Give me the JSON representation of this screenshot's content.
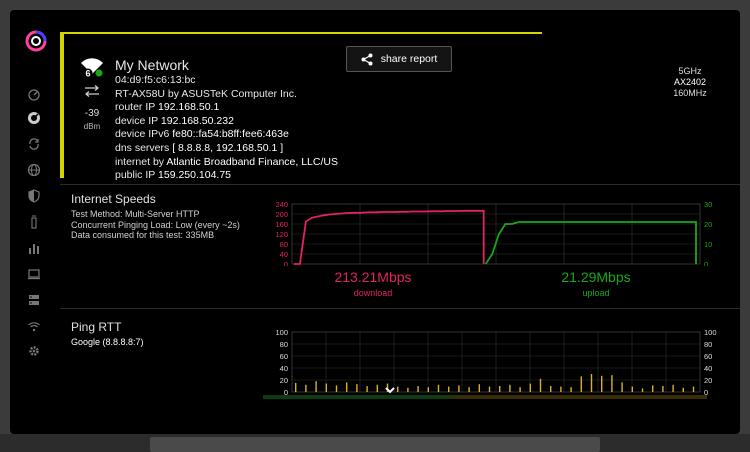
{
  "network": {
    "name": "My Network",
    "mac": "04:d9:f5:c6:13:bc",
    "router_model": "RT-AX58U by ASUSTeK Computer Inc.",
    "router_ip_label": "router IP",
    "router_ip": "192.168.50.1",
    "device_ip_label": "device IP",
    "device_ip": "192.168.50.232",
    "device_ipv6_label": "device IPv6",
    "device_ipv6": "fe80::fa54:b8ff:fee6:463e",
    "dns_label": "dns servers",
    "dns": "[ 8.8.8.8, 192.168.50.1 ]",
    "internet_label": "internet by",
    "internet": "Atlantic Broadband Finance, LLC/US",
    "public_ip_label": "public IP",
    "public_ip": "159.250.104.75",
    "wifi_badge": "6",
    "rssi": "-39",
    "rssi_unit": "dBm",
    "band": "5GHz",
    "standard": "AX2402",
    "width": "160MHz"
  },
  "share_label": "share report",
  "speeds": {
    "title": "Internet Speeds",
    "method": "Test Method: Multi-Server HTTP",
    "load": "Concurrent Pinging Load: Low (every ~2s)",
    "consumed": "Data consumed for this test: 335MB",
    "download_value": "213.21Mbps",
    "download_label": "download",
    "upload_value": "21.29Mbps",
    "upload_label": "upload"
  },
  "ping": {
    "title": "Ping RTT",
    "target": "Google (8.8.8.8:7)"
  },
  "colors": {
    "download": "#e0245e",
    "upload": "#17a817",
    "ping_bar": "#d9b21c",
    "accent": "#d3d600"
  },
  "icons": [
    "logo-icon",
    "speedometer-icon",
    "gauge-icon",
    "refresh-icon",
    "globe-icon",
    "shield-icon",
    "router-icon",
    "bar-chart-icon",
    "laptop-icon",
    "server-icon",
    "wifi-icon",
    "gear-icon"
  ],
  "chart_data": [
    {
      "type": "line",
      "title": "",
      "ylim": [
        0,
        240
      ],
      "yticks_left": [
        "240",
        "200",
        "160",
        "120",
        "80",
        "40",
        "0"
      ],
      "yticks_right": [
        "30",
        "20",
        "10",
        "0"
      ],
      "series": [
        {
          "name": "download",
          "axis": "left",
          "values": [
            0,
            0,
            170,
            185,
            190,
            195,
            198,
            200,
            202,
            204,
            205,
            205,
            206,
            207,
            207,
            208,
            208,
            208,
            209,
            209,
            210,
            210,
            210,
            211,
            211,
            211,
            212,
            212,
            212,
            213,
            213,
            213,
            213
          ]
        },
        {
          "name": "upload",
          "axis": "right",
          "values": [
            0,
            5,
            15,
            20,
            20,
            21,
            21,
            21,
            21,
            21,
            21,
            21,
            21,
            21,
            21,
            21,
            21,
            21,
            21,
            21,
            21,
            21,
            21,
            21,
            21,
            21,
            21,
            21,
            21,
            21,
            21,
            21,
            21
          ]
        }
      ]
    },
    {
      "type": "bar",
      "title": "",
      "ylim": [
        0,
        100
      ],
      "yticks": [
        "100",
        "80",
        "60",
        "40",
        "20",
        "0"
      ],
      "values": [
        15,
        12,
        18,
        14,
        11,
        16,
        13,
        10,
        12,
        14,
        9,
        7,
        10,
        8,
        12,
        9,
        11,
        8,
        13,
        9,
        10,
        12,
        8,
        14,
        22,
        10,
        9,
        8,
        26,
        30,
        27,
        28,
        16,
        9,
        6,
        11,
        10,
        12,
        7,
        9
      ]
    }
  ]
}
